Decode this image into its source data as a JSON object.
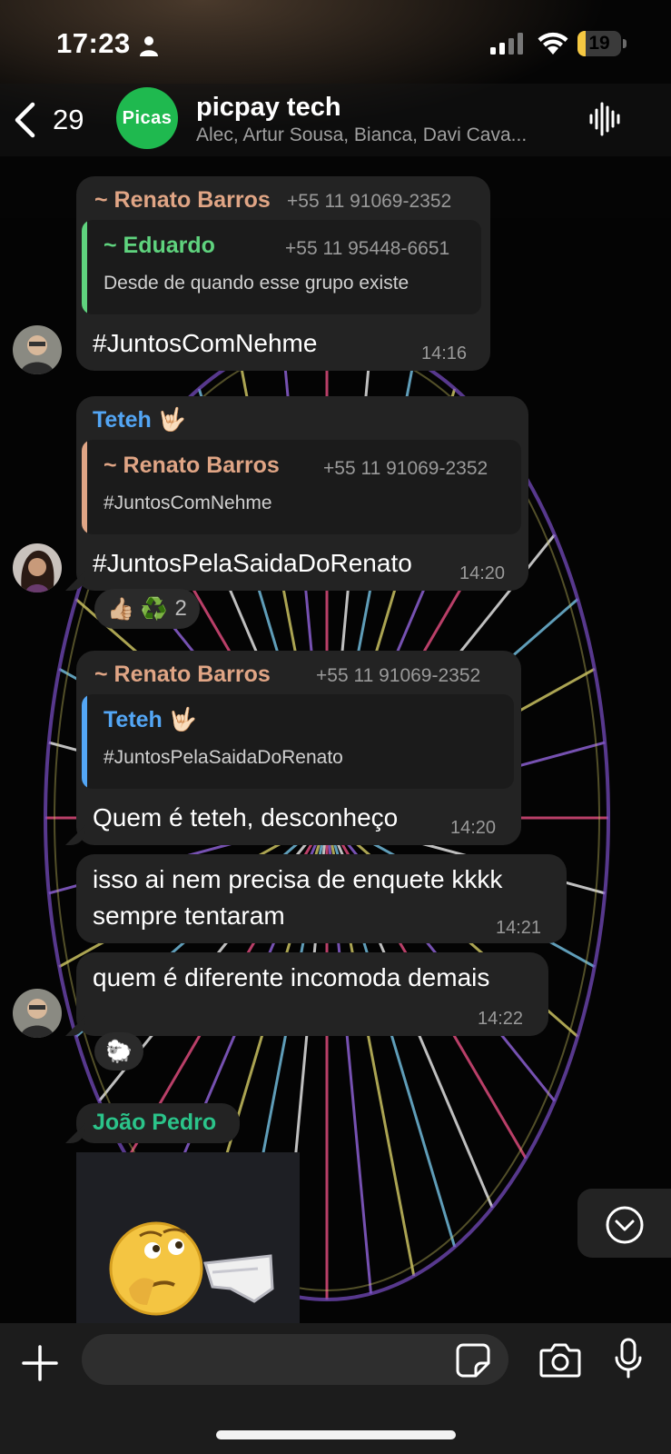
{
  "status_bar": {
    "time": "17:23",
    "battery": "19",
    "battery_level_percent": 19
  },
  "header": {
    "back_count": "29",
    "avatar_text": "Picas",
    "title": "picpay tech",
    "members": "Alec, Artur Sousa, Bianca, Davi Cava...",
    "icons": {
      "back": "chevron-left-icon",
      "voice": "voice-chat-icon"
    }
  },
  "messages": [
    {
      "sender": "~ Renato Barros",
      "phone": "+55 11 91069-2352",
      "quote": {
        "sender": "~ Eduardo",
        "phone": "+55 11 95448-6651",
        "text": "Desde de quando esse grupo existe"
      },
      "text": "#JuntosComNehme",
      "time": "14:16"
    },
    {
      "sender": "Teteh 🤟🏻",
      "quote": {
        "sender": "~ Renato Barros",
        "phone": "+55 11 91069-2352",
        "text": "#JuntosComNehme"
      },
      "text": "#JuntosPelaSaidaDoRenato",
      "time": "14:20",
      "reactions": {
        "emojis": "👍🏼 ♻️",
        "count": "2"
      }
    },
    {
      "sender": "~ Renato Barros",
      "phone": "+55 11 91069-2352",
      "quote": {
        "sender": "Teteh 🤟🏻",
        "text": "#JuntosPelaSaidaDoRenato"
      },
      "text": "Quem é teteh, desconheço",
      "time": "14:20"
    },
    {
      "text_line1": "isso ai nem precisa de enquete kkkk",
      "text_line2": "sempre tentaram",
      "time": "14:21"
    },
    {
      "text": "quem é diferente incomoda demais",
      "time": "14:22",
      "reactions": {
        "emojis": "🐑"
      }
    },
    {
      "sender": "João Pedro",
      "sticker": "thinking-face-finger-gun-sticker"
    }
  ],
  "composer": {
    "placeholder": "",
    "icons": {
      "plus": "plus-icon",
      "sticker": "sticker-icon",
      "camera": "camera-icon",
      "mic": "microphone-icon"
    }
  },
  "colors": {
    "renato": "#e0a585",
    "eduardo": "#5fd37e",
    "teteh": "#53a6f5",
    "joao": "#2bc48a",
    "bubble": "#232323",
    "group_avatar": "#1fb94f"
  }
}
